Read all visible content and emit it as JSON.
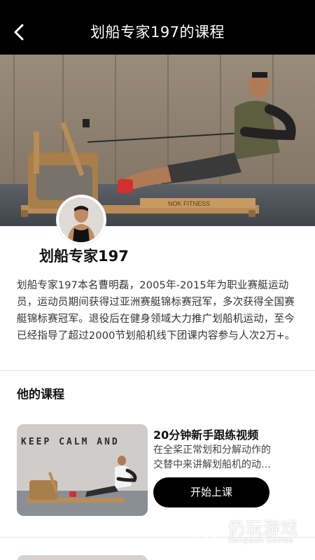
{
  "header": {
    "title": "划船专家197的课程",
    "back_icon": "chevron-left-icon"
  },
  "hero": {
    "machine_brand": "NOK FITNESS"
  },
  "coach": {
    "name": "划船专家197",
    "bio": "划船专家197本名曹明磊，2005年-2015年为职业赛艇运动员，运动员期间获得过亚洲赛艇锦标赛冠军，多次获得全国赛艇锦标赛冠军。退役后在健身领域大力推广划船机运动，至今已经指导了超过2000节划船机线下团课内容参与人次2万+。"
  },
  "courses_section": {
    "title": "他的课程",
    "courses": [
      {
        "thumbnail_caption": "KEEP CALM AND",
        "title": "20分钟新手跟练视频",
        "desc_line1": "在全桨正常划和分解动作的",
        "desc_line2": "交替中来讲解划船机的动…",
        "button_label": "开始上课"
      }
    ]
  },
  "watermark": {
    "name": "仍玩游戏",
    "sub": "Rengwan Games"
  },
  "colors": {
    "header_bg": "#000000",
    "button_bg": "#000000",
    "text_primary": "#111111"
  }
}
